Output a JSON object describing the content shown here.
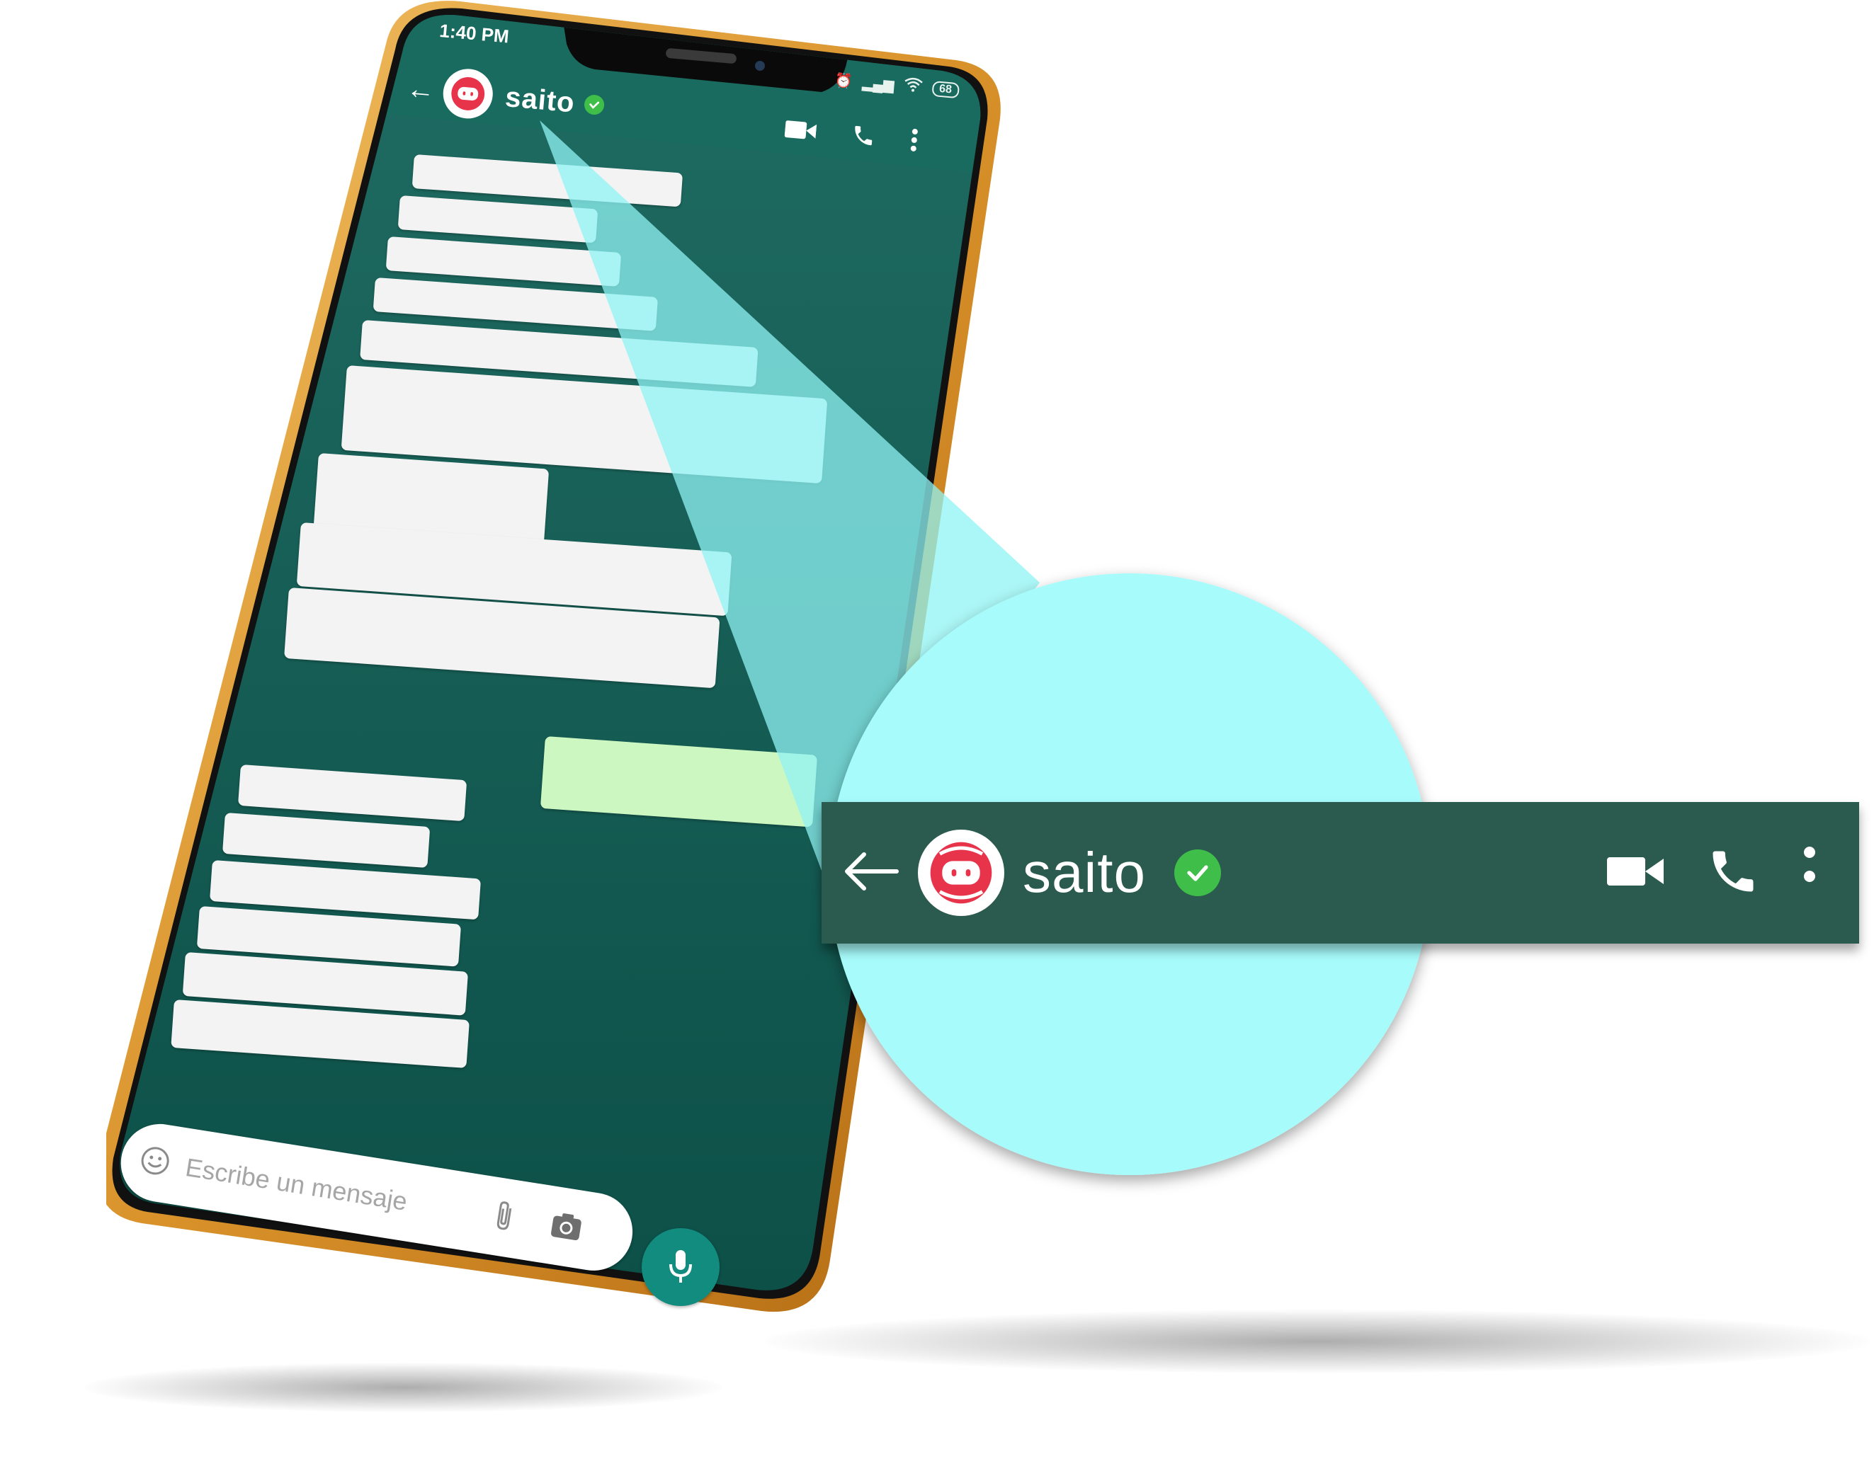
{
  "status_bar": {
    "time": "1:40 PM",
    "battery": "68"
  },
  "chat_header": {
    "contact_name": "saito",
    "verified": true,
    "icons": [
      "back-arrow-icon",
      "saito-logo-icon",
      "verified-check-icon",
      "video-call-icon",
      "phone-call-icon",
      "more-options-icon"
    ]
  },
  "composer": {
    "placeholder": "Escribe un mensaje",
    "icons": [
      "emoji-icon",
      "attach-clip-icon",
      "camera-icon",
      "microphone-icon"
    ]
  },
  "zoomed_header": {
    "contact_name": "saito",
    "verified": true
  },
  "colors": {
    "header_green": "#2a5b4e",
    "chat_bg": "#0f5a52",
    "incoming_bubble": "#f3f3f3",
    "outgoing_bubble": "#cdf7c1",
    "callout_cyan": "#a7fbfb",
    "verified_green": "#3fbf4a",
    "brand_red": "#e8344a",
    "phone_frame_gold": "#e2a036"
  }
}
